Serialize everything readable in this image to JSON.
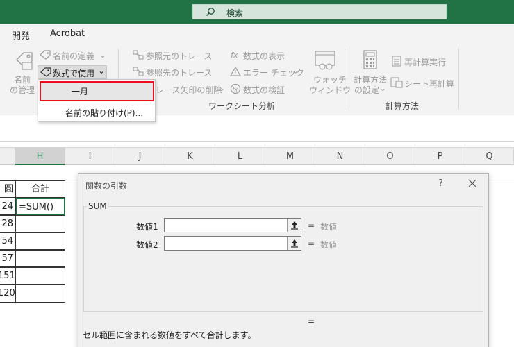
{
  "search": {
    "placeholder": "検索"
  },
  "tabs": [
    {
      "label": "開発"
    },
    {
      "label": "Acrobat"
    }
  ],
  "ribbon": {
    "define_name": {
      "line1": "名前",
      "line2": "の管理"
    },
    "name_define": "名前の定義",
    "use_in_formula": "数式で使用",
    "trace_precedents": "参照元のトレース",
    "trace_dependents": "参照先のトレース",
    "remove_arrows": "レース矢印の削除",
    "show_formulas": "数式の表示",
    "error_check": "エラー チェック",
    "evaluate_formula": "数式の検証",
    "watch_window": {
      "line1": "ウォッチ",
      "line2": "ウィンドウ"
    },
    "calc_options": {
      "line1": "計算方法",
      "line2": "の設定"
    },
    "calc_now": "再計算実行",
    "calc_sheet": "シート再計算",
    "group_audit": "ワークシート分析",
    "group_calc": "計算方法"
  },
  "dropdown": {
    "items": [
      {
        "label": "一月"
      },
      {
        "label": "名前の貼り付け(P)..."
      }
    ]
  },
  "columns": [
    "H",
    "I",
    "J",
    "K",
    "L",
    "M",
    "N",
    "O",
    "P",
    "Q"
  ],
  "grid": {
    "col_g_header_fragment": "圓",
    "header_h": "合計",
    "formula_cell": "=SUM()",
    "g_values": [
      "24",
      "28",
      "54",
      "57",
      "151",
      "120"
    ]
  },
  "dialog": {
    "title": "関数の引数",
    "help": "?",
    "function_name": "SUM",
    "args": [
      {
        "label": "数値1",
        "eq": "=",
        "value": "数値"
      },
      {
        "label": "数値2",
        "eq": "=",
        "value": "数値"
      }
    ],
    "result_eq": "=",
    "description": "セル範囲に含まれる数値をすべて合計します。"
  },
  "colors": {
    "excel_green": "#217346",
    "highlight_red": "#e81123"
  }
}
